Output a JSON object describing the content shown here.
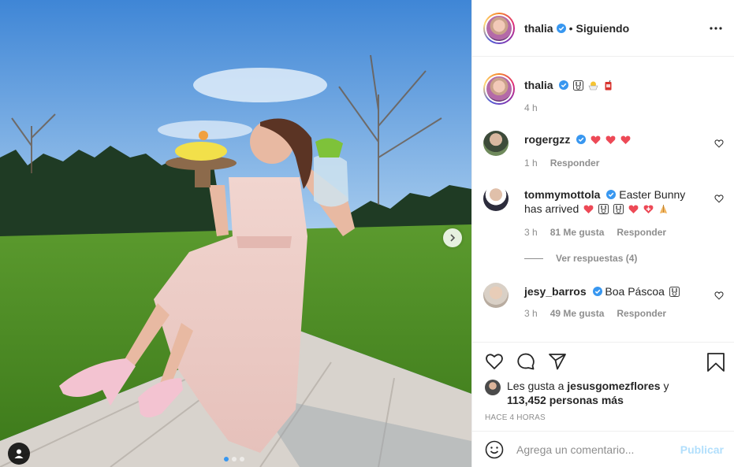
{
  "post": {
    "author": "thalia",
    "follow_status": "Siguiendo",
    "separator": "•",
    "carousel": {
      "total_slides": 3,
      "active_slide": 1
    }
  },
  "caption": {
    "username": "thalia",
    "text": "",
    "emojis": [
      "bunny-emoji",
      "hatching-chick-emoji",
      "juice-box-emoji"
    ],
    "time": "4 h"
  },
  "comments": [
    {
      "username": "rogergzz",
      "verified": true,
      "text": "",
      "emojis": [
        "heart",
        "heart",
        "heart"
      ],
      "time": "1 h",
      "likes": "",
      "reply_label": "Responder"
    },
    {
      "username": "tommymottola",
      "verified": true,
      "text": "Easter Bunny has arrived",
      "emojis": [
        "heart",
        "bunny",
        "bunny",
        "heart",
        "heart-plus",
        "praying-hands"
      ],
      "time": "3 h",
      "likes": "81 Me gusta",
      "reply_label": "Responder",
      "view_replies": "Ver respuestas (4)"
    },
    {
      "username": "jesy_barros",
      "verified": true,
      "text": "Boa Páscoa",
      "emojis": [
        "bunny"
      ],
      "time": "3 h",
      "likes": "49 Me gusta",
      "reply_label": "Responder"
    }
  ],
  "likes": {
    "prefix": "Les gusta a",
    "user": "jesusgomezflores",
    "conjunction": "y",
    "count": "113,452 personas más"
  },
  "timestamp": "HACE 4 HORAS",
  "comment_box": {
    "placeholder": "Agrega un comentario...",
    "publish_label": "Publicar"
  },
  "colors": {
    "verified": "#3897f0",
    "heart_red": "#ed4956",
    "publish_disabled": "#b2dffc",
    "muted_text": "#8e8e8e"
  }
}
